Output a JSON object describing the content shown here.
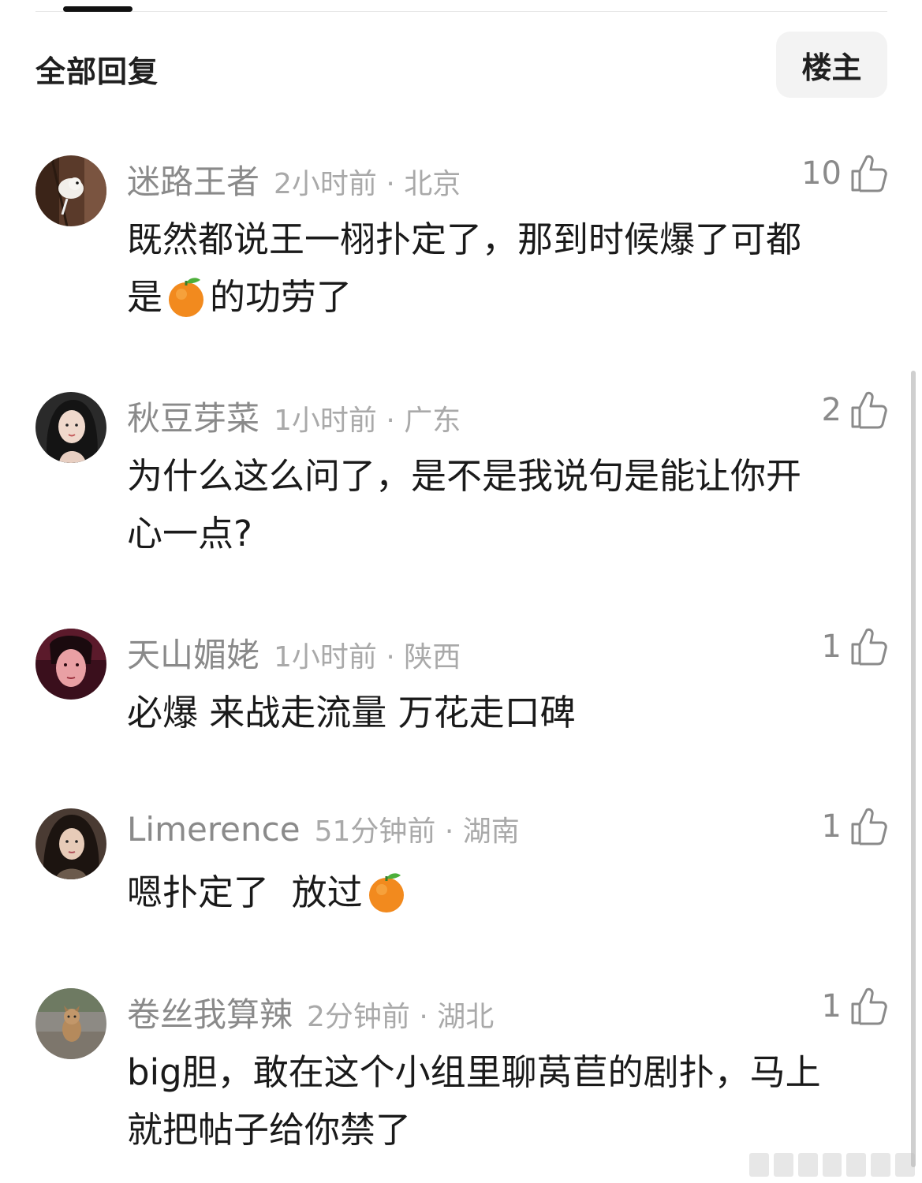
{
  "header": {
    "title": "全部回复",
    "owner_button": "楼主"
  },
  "comments": [
    {
      "username": "迷路王者",
      "time_location": "2小时前 · 北京",
      "likes": "10",
      "line1": "既然都说王一栩扑定了，那到时候爆了可都",
      "line2_before": "是",
      "line2_emoji": "tangerine-emoji",
      "line2_after": "的功劳了"
    },
    {
      "username": "秋豆芽菜",
      "time_location": "1小时前 · 广东",
      "likes": "2",
      "line1": "为什么这么问了，是不是我说句是能让你开",
      "line2": "心一点?"
    },
    {
      "username": "天山媚姥",
      "time_location": "1小时前 · 陕西",
      "likes": "1",
      "line1": "必爆 来战走流量 万花走口碑"
    },
    {
      "username": "Limerence",
      "time_location": "51分钟前 · 湖南",
      "likes": "1",
      "line1_before": "嗯扑定了  放过",
      "line1_emoji": "tangerine-emoji"
    },
    {
      "username": "卷丝我算辣",
      "time_location": "2分钟前 · 湖北",
      "likes": "1",
      "line1": "big胆，敢在这个小组里聊莴苣的剧扑，马上",
      "line2": "就把帖子给你禁了"
    }
  ],
  "icons": {
    "like": "thumbs-up-icon",
    "emoji": "tangerine-emoji"
  },
  "colors": {
    "username": "#8a8a8a",
    "meta": "#a9a9a9",
    "text": "#1a1a1a",
    "owner_bg": "#f3f3f3"
  }
}
